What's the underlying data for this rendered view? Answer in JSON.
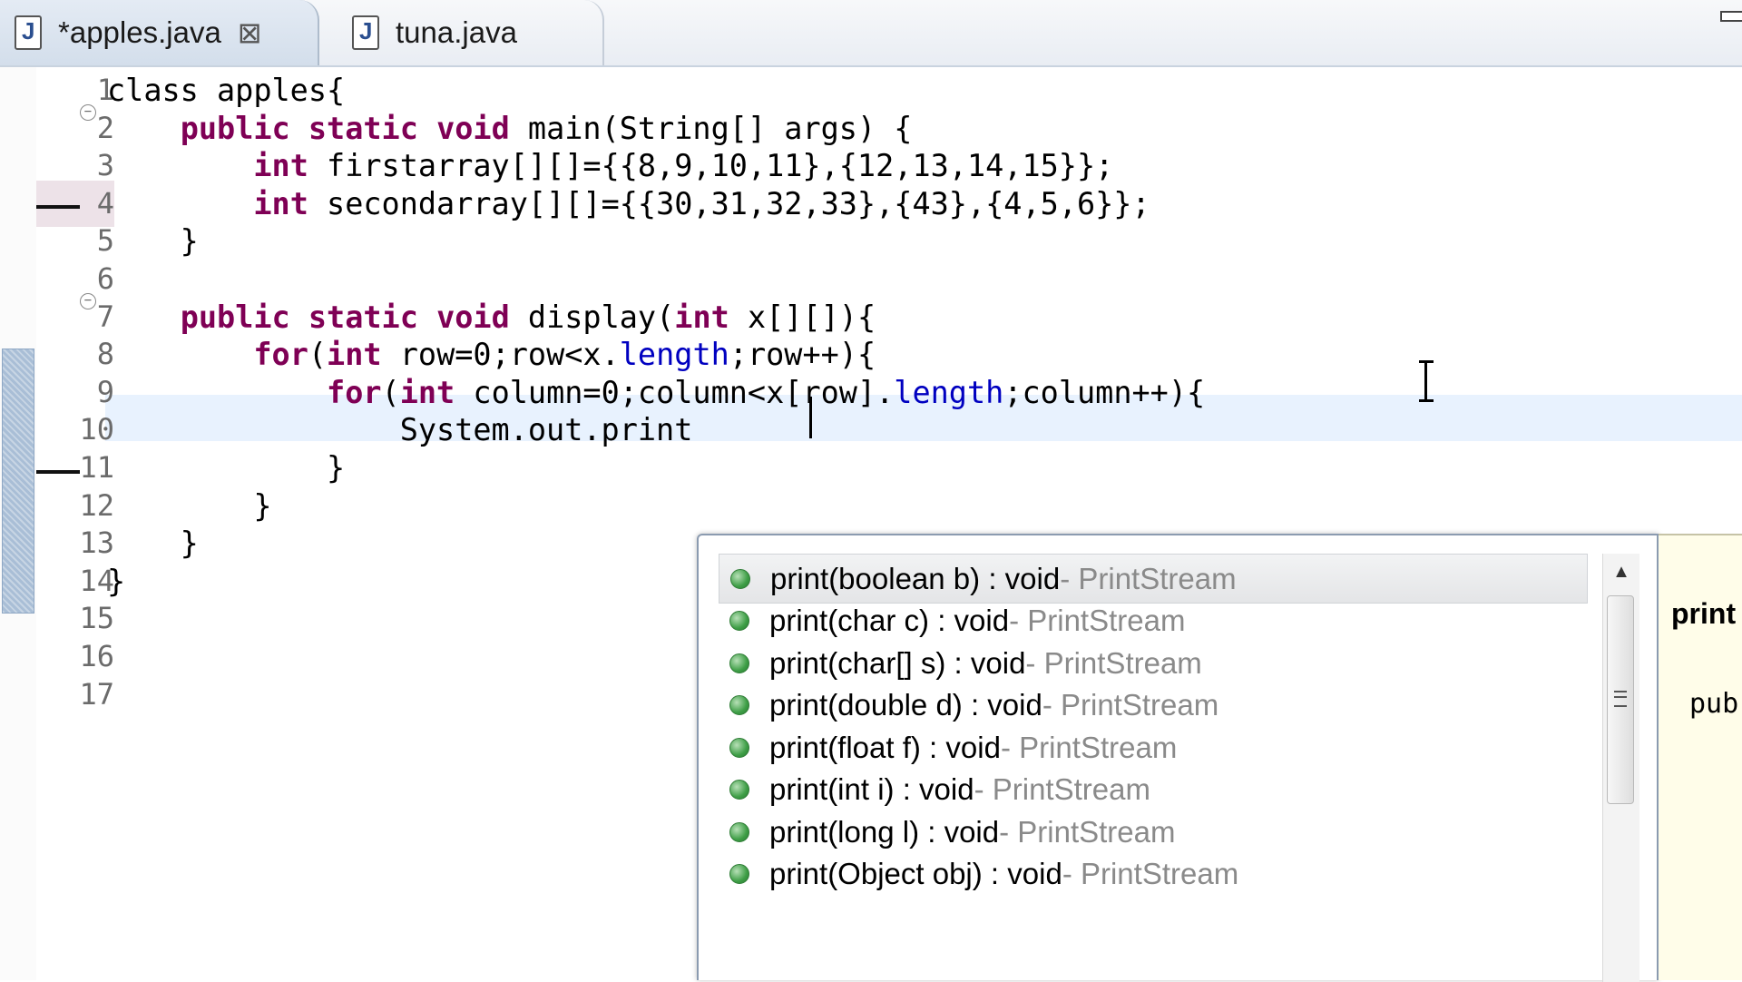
{
  "tabs": [
    {
      "label": "*apples.java",
      "active": true,
      "icon": "java-file-icon",
      "close": "⊠"
    },
    {
      "label": "tuna.java",
      "active": false,
      "icon": "java-file-icon"
    }
  ],
  "colors": {
    "keyword": "#7f0055",
    "field": "#0000c0",
    "current_line": "#e8f2fe",
    "proposal_icon": "#3e9e46"
  },
  "editor": {
    "line_numbers": [
      "1",
      "2",
      "3",
      "4",
      "5",
      "6",
      "7",
      "8",
      "9",
      "10",
      "11",
      "12",
      "13",
      "14",
      "15",
      "16",
      "17"
    ],
    "code": [
      [
        {
          "t": "class apples{"
        }
      ],
      [
        {
          "t": "    "
        },
        {
          "t": "public",
          "c": "kw"
        },
        {
          "t": " "
        },
        {
          "t": "static",
          "c": "kw"
        },
        {
          "t": " "
        },
        {
          "t": "void",
          "c": "kw"
        },
        {
          "t": " main(String[] args) {"
        }
      ],
      [
        {
          "t": "        "
        },
        {
          "t": "int",
          "c": "kw"
        },
        {
          "t": " firstarray[][]={{8,9,10,11},{12,13,14,15}};"
        }
      ],
      [
        {
          "t": "        "
        },
        {
          "t": "int",
          "c": "kw"
        },
        {
          "t": " secondarray[][]={{30,31,32,33},{43},{4,5,6}};"
        }
      ],
      [
        {
          "t": "    }"
        }
      ],
      [
        {
          "t": ""
        }
      ],
      [
        {
          "t": "    "
        },
        {
          "t": "public",
          "c": "kw"
        },
        {
          "t": " "
        },
        {
          "t": "static",
          "c": "kw"
        },
        {
          "t": " "
        },
        {
          "t": "void",
          "c": "kw"
        },
        {
          "t": " display("
        },
        {
          "t": "int",
          "c": "kw"
        },
        {
          "t": " x[][]){"
        }
      ],
      [
        {
          "t": "        "
        },
        {
          "t": "for",
          "c": "kw"
        },
        {
          "t": "("
        },
        {
          "t": "int",
          "c": "kw"
        },
        {
          "t": " row=0;row<x."
        },
        {
          "t": "length",
          "c": "fld"
        },
        {
          "t": ";row++){"
        }
      ],
      [
        {
          "t": "            "
        },
        {
          "t": "for",
          "c": "kw"
        },
        {
          "t": "("
        },
        {
          "t": "int",
          "c": "kw"
        },
        {
          "t": " column=0;column<x[row]."
        },
        {
          "t": "length",
          "c": "fld"
        },
        {
          "t": ";column++){"
        }
      ],
      [
        {
          "t": "                System.out.print"
        }
      ],
      [
        {
          "t": "            }"
        }
      ],
      [
        {
          "t": "        }"
        }
      ],
      [
        {
          "t": "    }"
        }
      ],
      [
        {
          "t": "}"
        }
      ],
      [
        {
          "t": ""
        }
      ],
      [
        {
          "t": ""
        }
      ],
      [
        {
          "t": ""
        }
      ]
    ]
  },
  "content_assist": {
    "proposals": [
      {
        "label": "print(boolean b) : void",
        "owner": " - PrintStream",
        "selected": true
      },
      {
        "label": "print(char c) : void",
        "owner": " - PrintStream"
      },
      {
        "label": "print(char[] s) : void",
        "owner": " - PrintStream"
      },
      {
        "label": "print(double d) : void",
        "owner": " - PrintStream"
      },
      {
        "label": "print(float f) : void",
        "owner": " - PrintStream"
      },
      {
        "label": "print(int i) : void",
        "owner": " - PrintStream"
      },
      {
        "label": "print(long l) : void",
        "owner": " - PrintStream"
      },
      {
        "label": "print(Object obj) : void",
        "owner": " - PrintStream"
      }
    ]
  },
  "doc": {
    "title": "print",
    "signature": "pub"
  }
}
